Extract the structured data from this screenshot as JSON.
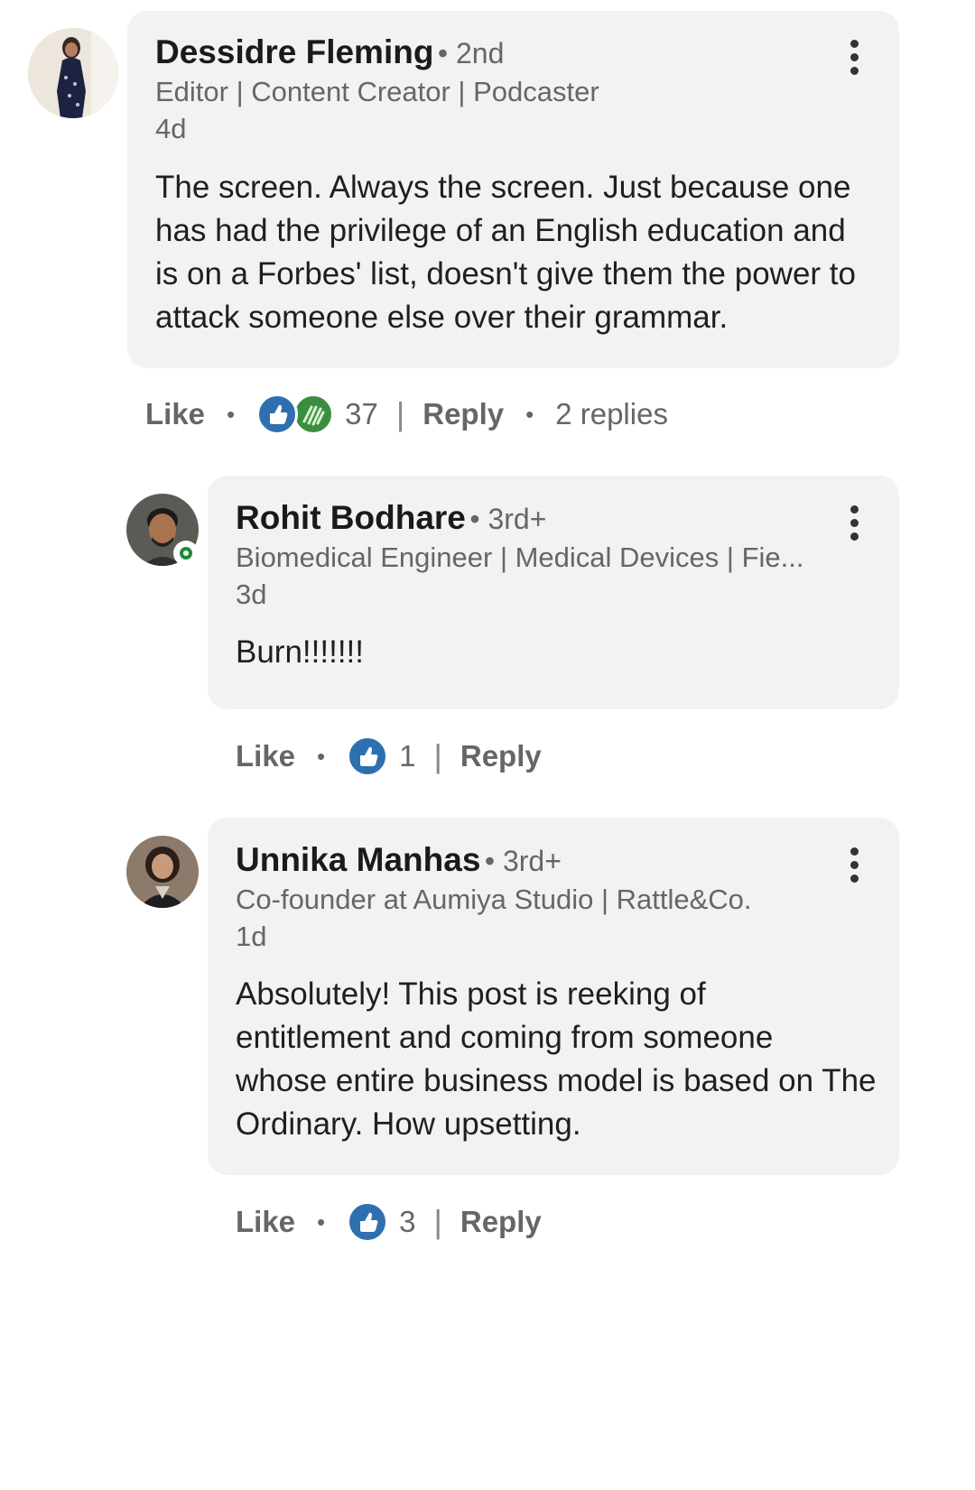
{
  "comments": [
    {
      "name": "Dessidre Fleming",
      "degree": "• 2nd",
      "headline": "Editor | Content Creator | Podcaster",
      "time": "4d",
      "body": [
        "The screen. Always the screen. Just because one",
        "has had the privilege of an English education and",
        "is on a Forbes' list, doesn't give them the power to",
        "attack someone else over their grammar."
      ],
      "like_label": "Like",
      "reaction_count": "37",
      "reply_label": "Reply",
      "replies_label": "2 replies"
    },
    {
      "name": "Rohit Bodhare",
      "degree": "• 3rd+",
      "headline": "Biomedical Engineer | Medical Devices | Fie...",
      "time": "3d",
      "body": [
        "Burn!!!!!!!"
      ],
      "like_label": "Like",
      "reaction_count": "1",
      "reply_label": "Reply"
    },
    {
      "name": "Unnika Manhas",
      "degree": "• 3rd+",
      "headline": "Co-founder at Aumiya Studio | Rattle&Co.",
      "time": "1d",
      "body": [
        "Absolutely! This post is reeking of",
        "entitlement and coming from someone",
        "whose entire business model is based on The",
        "Ordinary. How upsetting."
      ],
      "like_label": "Like",
      "reaction_count": "3",
      "reply_label": "Reply"
    }
  ],
  "icons": {
    "more": "more-vertical-icon",
    "like": "like-reaction-icon",
    "clap": "celebrate-reaction-icon"
  },
  "colors": {
    "bubble": "#f2f2f2",
    "like_reaction": "#2e6fb0",
    "celebrate_reaction": "#3a8f3e",
    "online_status": "#1f8a3c"
  }
}
